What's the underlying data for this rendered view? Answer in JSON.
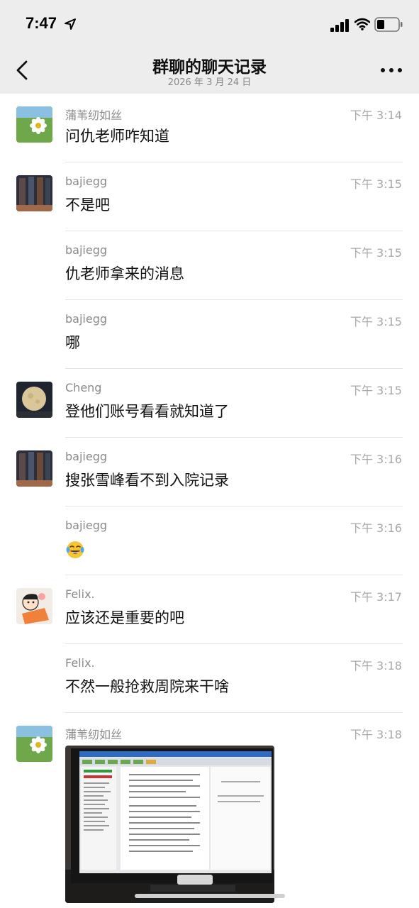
{
  "status": {
    "time": "7:47"
  },
  "header": {
    "title": "群聊的聊天记录",
    "date": "2026 年 3 月 24 日"
  },
  "messages": [
    {
      "sender": "蒲苇纫如丝",
      "time": "下午 3:14",
      "text": "问仇老师咋知道",
      "avatar": "daisy-avatar"
    },
    {
      "sender": "bajiegg",
      "time": "下午 3:15",
      "text": "不是吧",
      "avatar": "building-avatar"
    },
    {
      "sender": "bajiegg",
      "time": "下午 3:15",
      "text": "仇老师拿来的消息"
    },
    {
      "sender": "bajiegg",
      "time": "下午 3:15",
      "text": "哪"
    },
    {
      "sender": "Cheng",
      "time": "下午 3:15",
      "text": "登他们账号看看就知道了",
      "avatar": "moon-avatar"
    },
    {
      "sender": "bajiegg",
      "time": "下午 3:16",
      "text": "搜张雪峰看不到入院记录",
      "avatar": "building-avatar"
    },
    {
      "sender": "bajiegg",
      "time": "下午 3:16",
      "emoji": "laughing-tears-emoji"
    },
    {
      "sender": "Felix.",
      "time": "下午 3:17",
      "text": "应该还是重要的吧",
      "avatar": "cartoon-avatar"
    },
    {
      "sender": "Felix.",
      "time": "下午 3:18",
      "text": "不然一般抢救周院来干啥"
    },
    {
      "sender": "蒲苇纫如丝",
      "time": "下午 3:18",
      "image": "monitor-photo",
      "avatar": "daisy-avatar"
    }
  ],
  "colors": {
    "header_bg": "#ededed",
    "sender": "#8a8a8a",
    "time": "#a8a8a8",
    "divider": "#e4e4e4"
  }
}
